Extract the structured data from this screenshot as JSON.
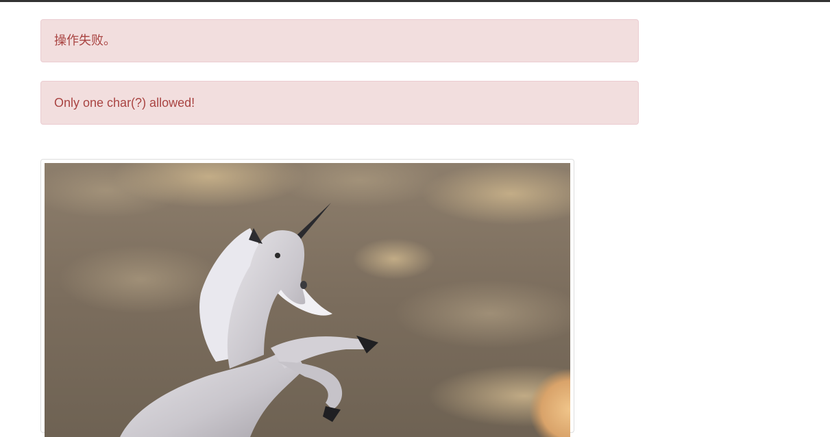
{
  "alerts": [
    {
      "text": "操作失败。"
    },
    {
      "text": "Only one char(?) allowed!"
    }
  ],
  "image": {
    "subject": "unicorn-illustration"
  },
  "colors": {
    "alert_bg": "#f2dede",
    "alert_border": "#ebccd1",
    "alert_text": "#a94442",
    "top_bar": "#333333"
  }
}
